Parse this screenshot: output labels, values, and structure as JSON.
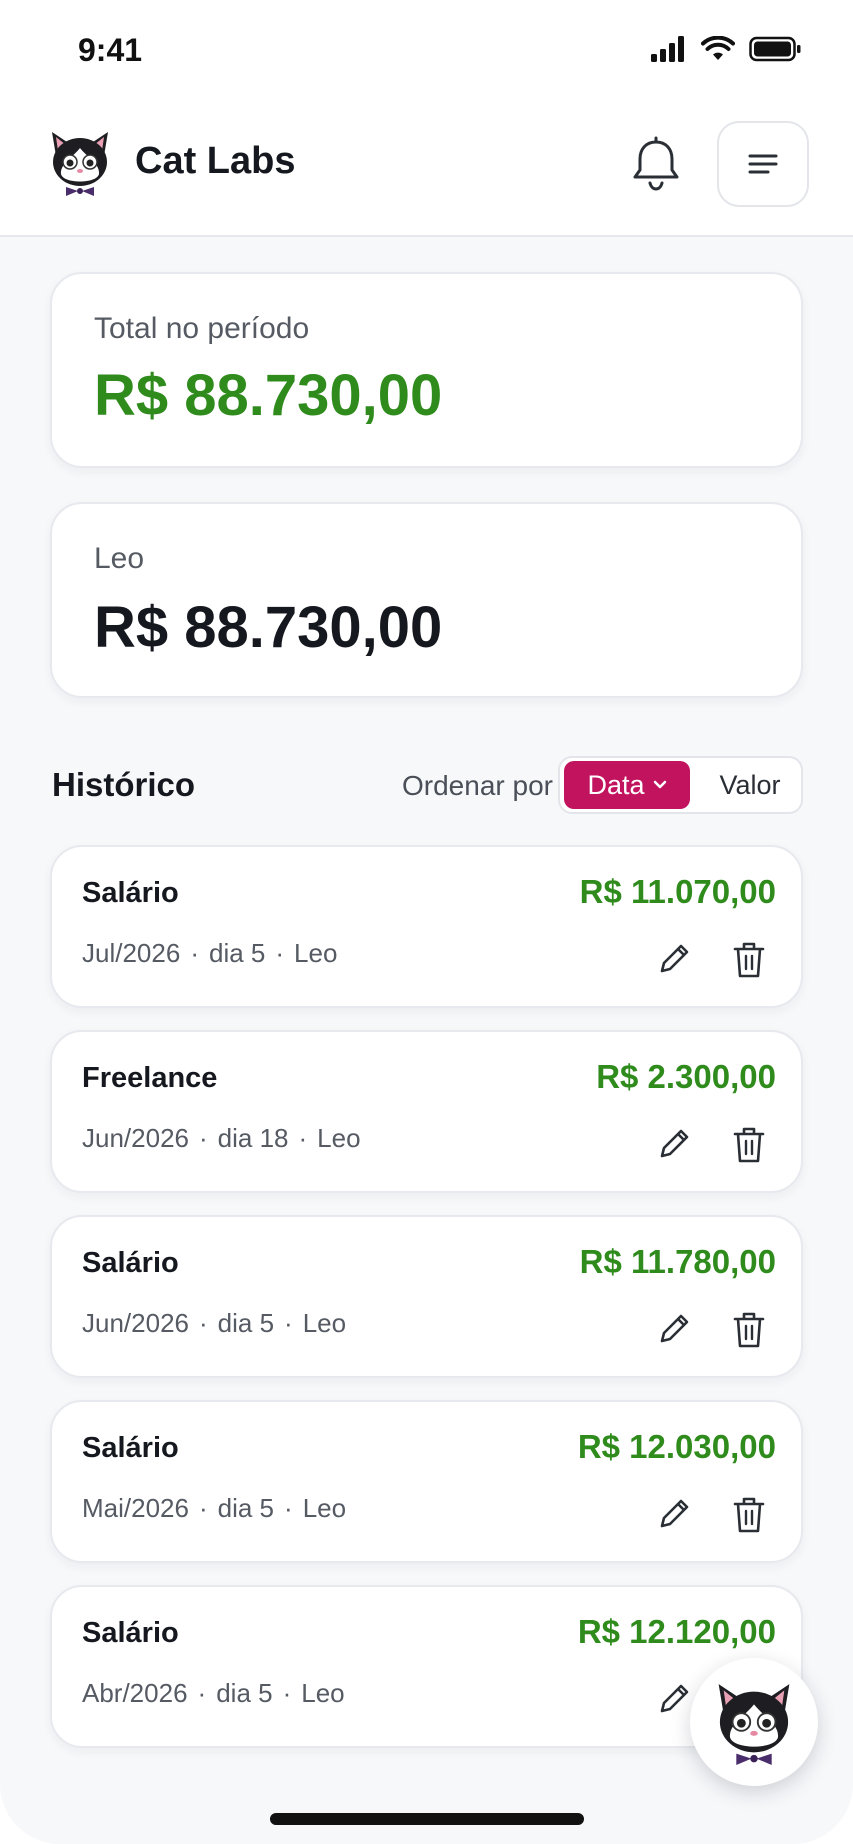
{
  "status_bar": {
    "time": "9:41"
  },
  "header": {
    "title": "Cat Labs"
  },
  "summary": {
    "period_label": "Total no período",
    "period_value": "R$ 88.730,00",
    "person_label": "Leo",
    "person_value": "R$ 88.730,00"
  },
  "history": {
    "title": "Histórico",
    "sort_label": "Ordenar por",
    "sort_options": [
      "Data",
      "Valor"
    ],
    "selected_sort": "Data"
  },
  "entries": [
    {
      "title": "Salário",
      "amount": "R$ 11.070,00",
      "month": "Jul/2026",
      "day": "dia 5",
      "person": "Leo"
    },
    {
      "title": "Freelance",
      "amount": "R$ 2.300,00",
      "month": "Jun/2026",
      "day": "dia 18",
      "person": "Leo"
    },
    {
      "title": "Salário",
      "amount": "R$ 11.780,00",
      "month": "Jun/2026",
      "day": "dia 5",
      "person": "Leo"
    },
    {
      "title": "Salário",
      "amount": "R$ 12.030,00",
      "month": "Mai/2026",
      "day": "dia 5",
      "person": "Leo"
    },
    {
      "title": "Salário",
      "amount": "R$ 12.120,00",
      "month": "Abr/2026",
      "day": "dia 5",
      "person": "Leo"
    }
  ],
  "meta_separator": "·",
  "icons": {
    "logo": "cat-mascot-icon",
    "notifications": "bell-icon",
    "menu": "hamburger-menu-icon",
    "sort_dropdown": "chevron-down-icon",
    "edit": "pencil-icon",
    "delete": "trash-icon",
    "fab": "cat-mascot-icon"
  },
  "colors": {
    "income_green": "#2e8b1c",
    "accent_magenta": "#c2135f",
    "text_dark": "#15181e",
    "muted": "#555a63"
  }
}
